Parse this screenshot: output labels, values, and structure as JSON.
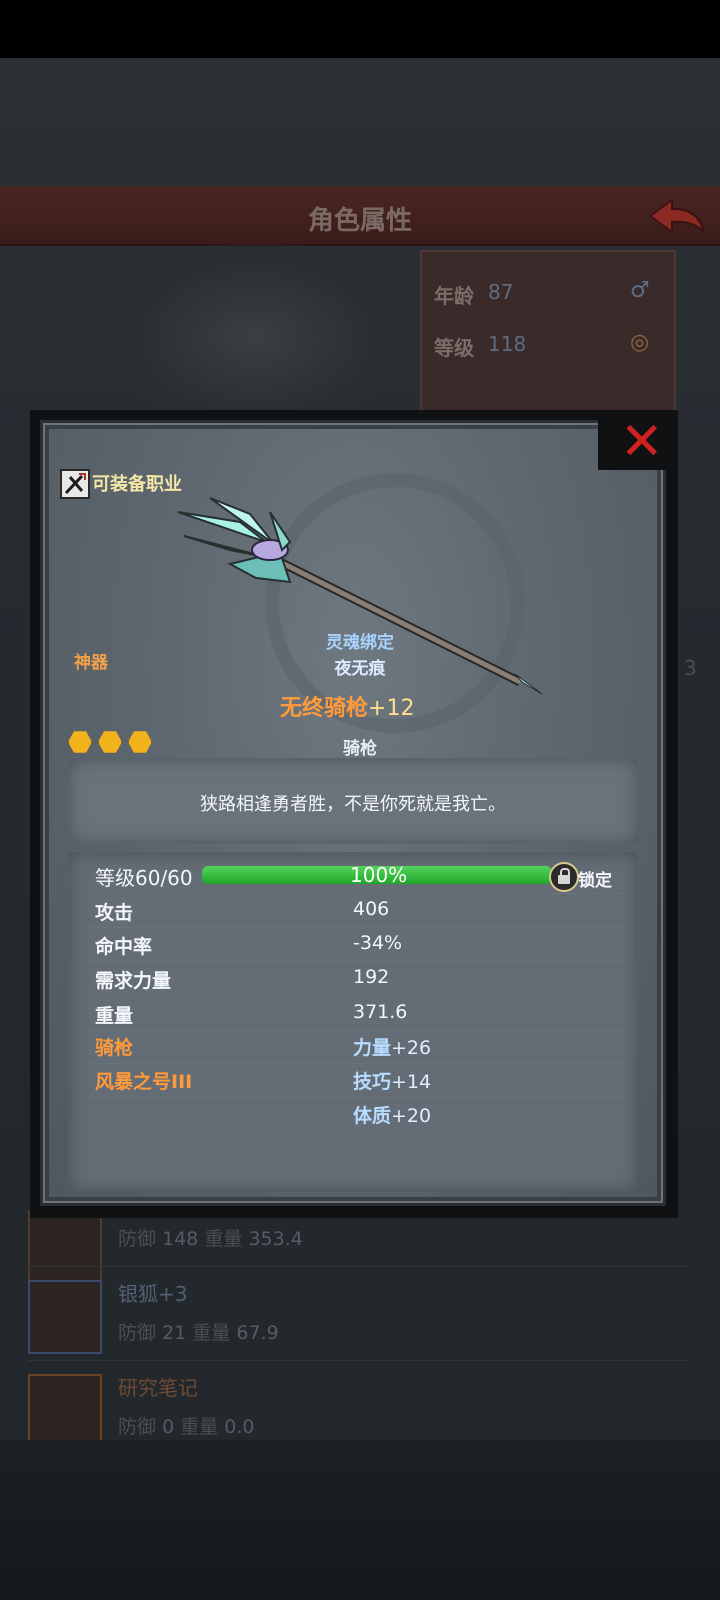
{
  "header": {
    "title": "角色属性"
  },
  "profile": {
    "age_label": "年龄",
    "age_value": "87",
    "level_label": "等级",
    "level_value": "118"
  },
  "equipment_list": [
    {
      "name": "",
      "defense_label": "防御",
      "defense": "148",
      "weight_label": "重量",
      "weight": "353.4"
    },
    {
      "name": "银狐+3",
      "defense_label": "防御",
      "defense": "21",
      "weight_label": "重量",
      "weight": "67.9"
    },
    {
      "name": "研究笔记",
      "defense_label": "防御",
      "defense": "0",
      "weight_label": "重量",
      "weight": "0.0"
    }
  ],
  "side_number": "3",
  "item": {
    "job_label": "可装备职业",
    "rarity": "神器",
    "soulbound": "灵魂绑定",
    "owner": "夜无痕",
    "name": "无终骑枪",
    "enhance": "+12",
    "stars": 3,
    "type": "骑枪",
    "description": "狭路相逢勇者胜，不是你死就是我亡。",
    "level_label": "等级60/60",
    "progress_percent": 100,
    "progress_text": "100%",
    "lock_label": "锁定",
    "stats": [
      {
        "label": "攻击",
        "value": "406"
      },
      {
        "label": "命中率",
        "value": "-34%"
      },
      {
        "label": "需求力量",
        "value": "192"
      },
      {
        "label": "重量",
        "value": "371.6"
      }
    ],
    "bonus_rows": [
      {
        "label": "骑枪",
        "stat": "力量",
        "amount": "+26"
      },
      {
        "label": "风暴之号III",
        "stat": "技巧",
        "amount": "+14"
      },
      {
        "label": "",
        "stat": "体质",
        "amount": "+20"
      }
    ]
  },
  "colors": {
    "rarity_orange": "#ff9a3a",
    "soulbound_blue": "#a8d4ff",
    "progress_green": "#1fa52a",
    "close_red": "#d0231f"
  },
  "icons": {
    "back": "back-arrow-icon",
    "close": "close-icon",
    "job": "job-class-icon",
    "lock": "lock-icon",
    "star": "star-icon",
    "male": "male-icon",
    "ring": "ring-icon"
  }
}
